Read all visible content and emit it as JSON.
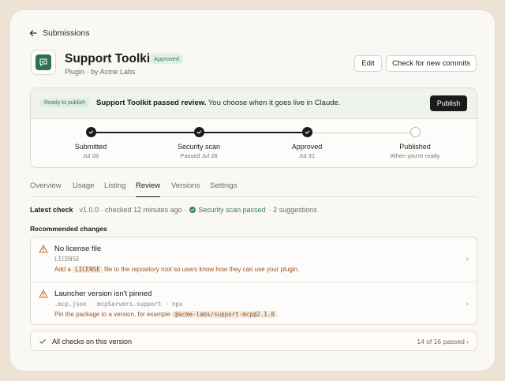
{
  "nav": {
    "back_label": "Submissions"
  },
  "app": {
    "title": "Support Toolkit",
    "status_badge": "Approved",
    "subtitle": "Plugin · by Acme Labs"
  },
  "actions": {
    "edit_label": "Edit",
    "check_commits_label": "Check for new commits"
  },
  "review": {
    "ready_badge": "Ready to publish",
    "message_bold": "Support Toolkit passed review.",
    "message_rest": " You choose when it goes live in Claude.",
    "publish_label": "Publish",
    "steps": [
      {
        "label": "Submitted",
        "date": "Jul 28",
        "done": true
      },
      {
        "label": "Security scan",
        "date": "Passed Jul 28",
        "done": true
      },
      {
        "label": "Approved",
        "date": "Jul 31",
        "done": true
      },
      {
        "label": "Published",
        "date": "When you're ready",
        "done": false
      }
    ]
  },
  "tabs": [
    "Overview",
    "Usage",
    "Listing",
    "Review",
    "Versions",
    "Settings"
  ],
  "active_tab": "Review",
  "latest_check": {
    "label": "Latest check",
    "meta": "v1.0.0 · checked 12 minutes ago ·",
    "scan_status": "Security scan passed",
    "suggestions": "· 2 suggestions"
  },
  "recommended": {
    "title": "Recommended changes",
    "items": [
      {
        "name": "No license file",
        "path": "LICENSE",
        "desc_before": "Add a ",
        "desc_code": "LICENSE",
        "desc_after": " file to the repository root so users know how they can use your plugin."
      },
      {
        "name": "Launcher version isn't pinned",
        "path": ".mcp.json · mcpServers.support · npx",
        "desc_before": "Pin the package to a version, for example ",
        "desc_code": "@acme-labs/support-mcp@2.1.0",
        "desc_after": "."
      }
    ]
  },
  "checks": {
    "label": "All checks on this version",
    "count": "14 of 16 passed ›"
  },
  "colors": {
    "accent_green": "#3d7a55",
    "warning_orange": "#c7772e",
    "dark": "#1c1b19"
  },
  "icons": [
    "arrow-left-icon",
    "chat-check-icon",
    "check-icon",
    "warning-icon",
    "chevron-right-icon"
  ]
}
